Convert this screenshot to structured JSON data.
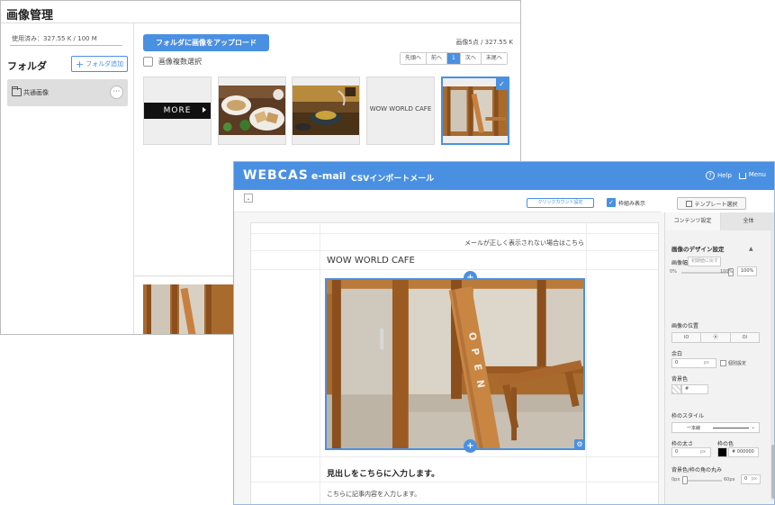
{
  "image_manager": {
    "title": "画像管理",
    "usage": "使用済み：327.55 K / 100 M",
    "folder_heading": "フォルダ",
    "add_folder_label": "フォルダ追加",
    "folder_item": "共通画像",
    "upload_button": "フォルダに画像をアップロード",
    "image_count": "画像5点 / 327.55 K",
    "multi_select": "画像複数選択",
    "pager": [
      "先頭へ",
      "前へ",
      "1",
      "次へ",
      "末尾へ"
    ],
    "pager_active": "1",
    "thumbs": {
      "more_text": "MORE",
      "wow_text": "WOW WORLD CAFE",
      "selected_index": 4
    }
  },
  "editor": {
    "logo": "WEBCAS",
    "logo_sub": "e-mail",
    "page_title": "CSVインポートメール",
    "help_label": "Help",
    "menu_label": "Menu",
    "click_count_button": "クリックカウント設定",
    "frame_toggle_label": "枠組み表示",
    "template_button": "テンプレート選択",
    "mail": {
      "notice": "メールが正しく表示されない場合はこちら",
      "brand": "WOW WORLD CAFE",
      "headline": "見出しをこちらに入力します。",
      "body": "こちらに記事内容を入力します。"
    },
    "panel": {
      "tabs": [
        "コンテンツ設定",
        "全体"
      ],
      "section_title": "画像のデザイン設定",
      "width_label": "画像幅",
      "width_reset": "初期値に戻す",
      "width_min": "0%",
      "width_max": "100%",
      "width_value": "100%",
      "width_fraction": 1.0,
      "position_label": "画像の位置",
      "position_opts": [
        "IO",
        "⦿",
        "OI"
      ],
      "margin_label": "余白",
      "margin_value": "0",
      "margin_unit": "px",
      "individual_label": "個別設定",
      "bg_label": "背景色",
      "bg_value": "#",
      "border_style_label": "枠のスタイル",
      "border_style_value": "一本線",
      "border_width_label": "枠の太さ",
      "border_width_value": "0",
      "border_width_unit": "px",
      "border_color_label": "枠の色",
      "border_color_value": "# 000000",
      "border_color_hex": "#000000",
      "radius_label": "背景色/枠の角の丸み",
      "radius_min": "0px",
      "radius_max": "60px",
      "radius_value": "0",
      "radius_unit": "px",
      "radius_fraction": 0.0
    }
  },
  "colors": {
    "accent": "#4a90e2"
  }
}
